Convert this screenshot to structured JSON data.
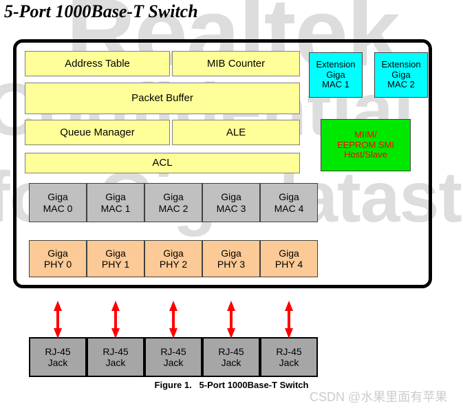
{
  "title": "5-Port 1000Base-T Switch",
  "caption": "Figure 1.   5-Port 1000Base-T Switch",
  "csdn_watermark": "CSDN @水果里面有苹果",
  "watermark": {
    "line1": "Realtek",
    "line2": "Confidential",
    "line3": "for Gigadatastream"
  },
  "colors": {
    "yellow_block": "#ffff99",
    "cyan_block": "#00ffff",
    "green_block": "#00e800",
    "gray_block": "#c0c0c0",
    "orange_block": "#fbca96",
    "jack_block": "#a6a6a6",
    "arrow": "#ff0000",
    "green_block_text": "#ff0000",
    "chip_border": "#000000",
    "watermark": "#dddddd"
  },
  "diagram": {
    "core_blocks": [
      {
        "label": "Address Table"
      },
      {
        "label": "MIB Counter"
      },
      {
        "label": "Packet Buffer"
      },
      {
        "label": "Queue Manager"
      },
      {
        "label": "ALE"
      },
      {
        "label": "ACL"
      }
    ],
    "extension_blocks": [
      {
        "line1": "Extension",
        "line2": "Giga",
        "line3": "MAC 1"
      },
      {
        "line1": "Extension",
        "line2": "Giga",
        "line3": "MAC 2"
      }
    ],
    "management_block": {
      "line1": "MIIM/",
      "line2": "EEPROM SMI",
      "line3": "Host/Slave"
    },
    "mac_row": [
      {
        "line1": "Giga",
        "line2": "MAC 0"
      },
      {
        "line1": "Giga",
        "line2": "MAC 1"
      },
      {
        "line1": "Giga",
        "line2": "MAC 2"
      },
      {
        "line1": "Giga",
        "line2": "MAC 3"
      },
      {
        "line1": "Giga",
        "line2": "MAC 4"
      }
    ],
    "phy_row": [
      {
        "line1": "Giga",
        "line2": "PHY 0"
      },
      {
        "line1": "Giga",
        "line2": "PHY 1"
      },
      {
        "line1": "Giga",
        "line2": "PHY 2"
      },
      {
        "line1": "Giga",
        "line2": "PHY 3"
      },
      {
        "line1": "Giga",
        "line2": "PHY 4"
      }
    ],
    "jack_row": [
      {
        "line1": "RJ-45",
        "line2": "Jack"
      },
      {
        "line1": "RJ-45",
        "line2": "Jack"
      },
      {
        "line1": "RJ-45",
        "line2": "Jack"
      },
      {
        "line1": "RJ-45",
        "line2": "Jack"
      },
      {
        "line1": "RJ-45",
        "line2": "Jack"
      }
    ],
    "connector_count": 5,
    "connector_kind": "bidirectional-arrow"
  }
}
